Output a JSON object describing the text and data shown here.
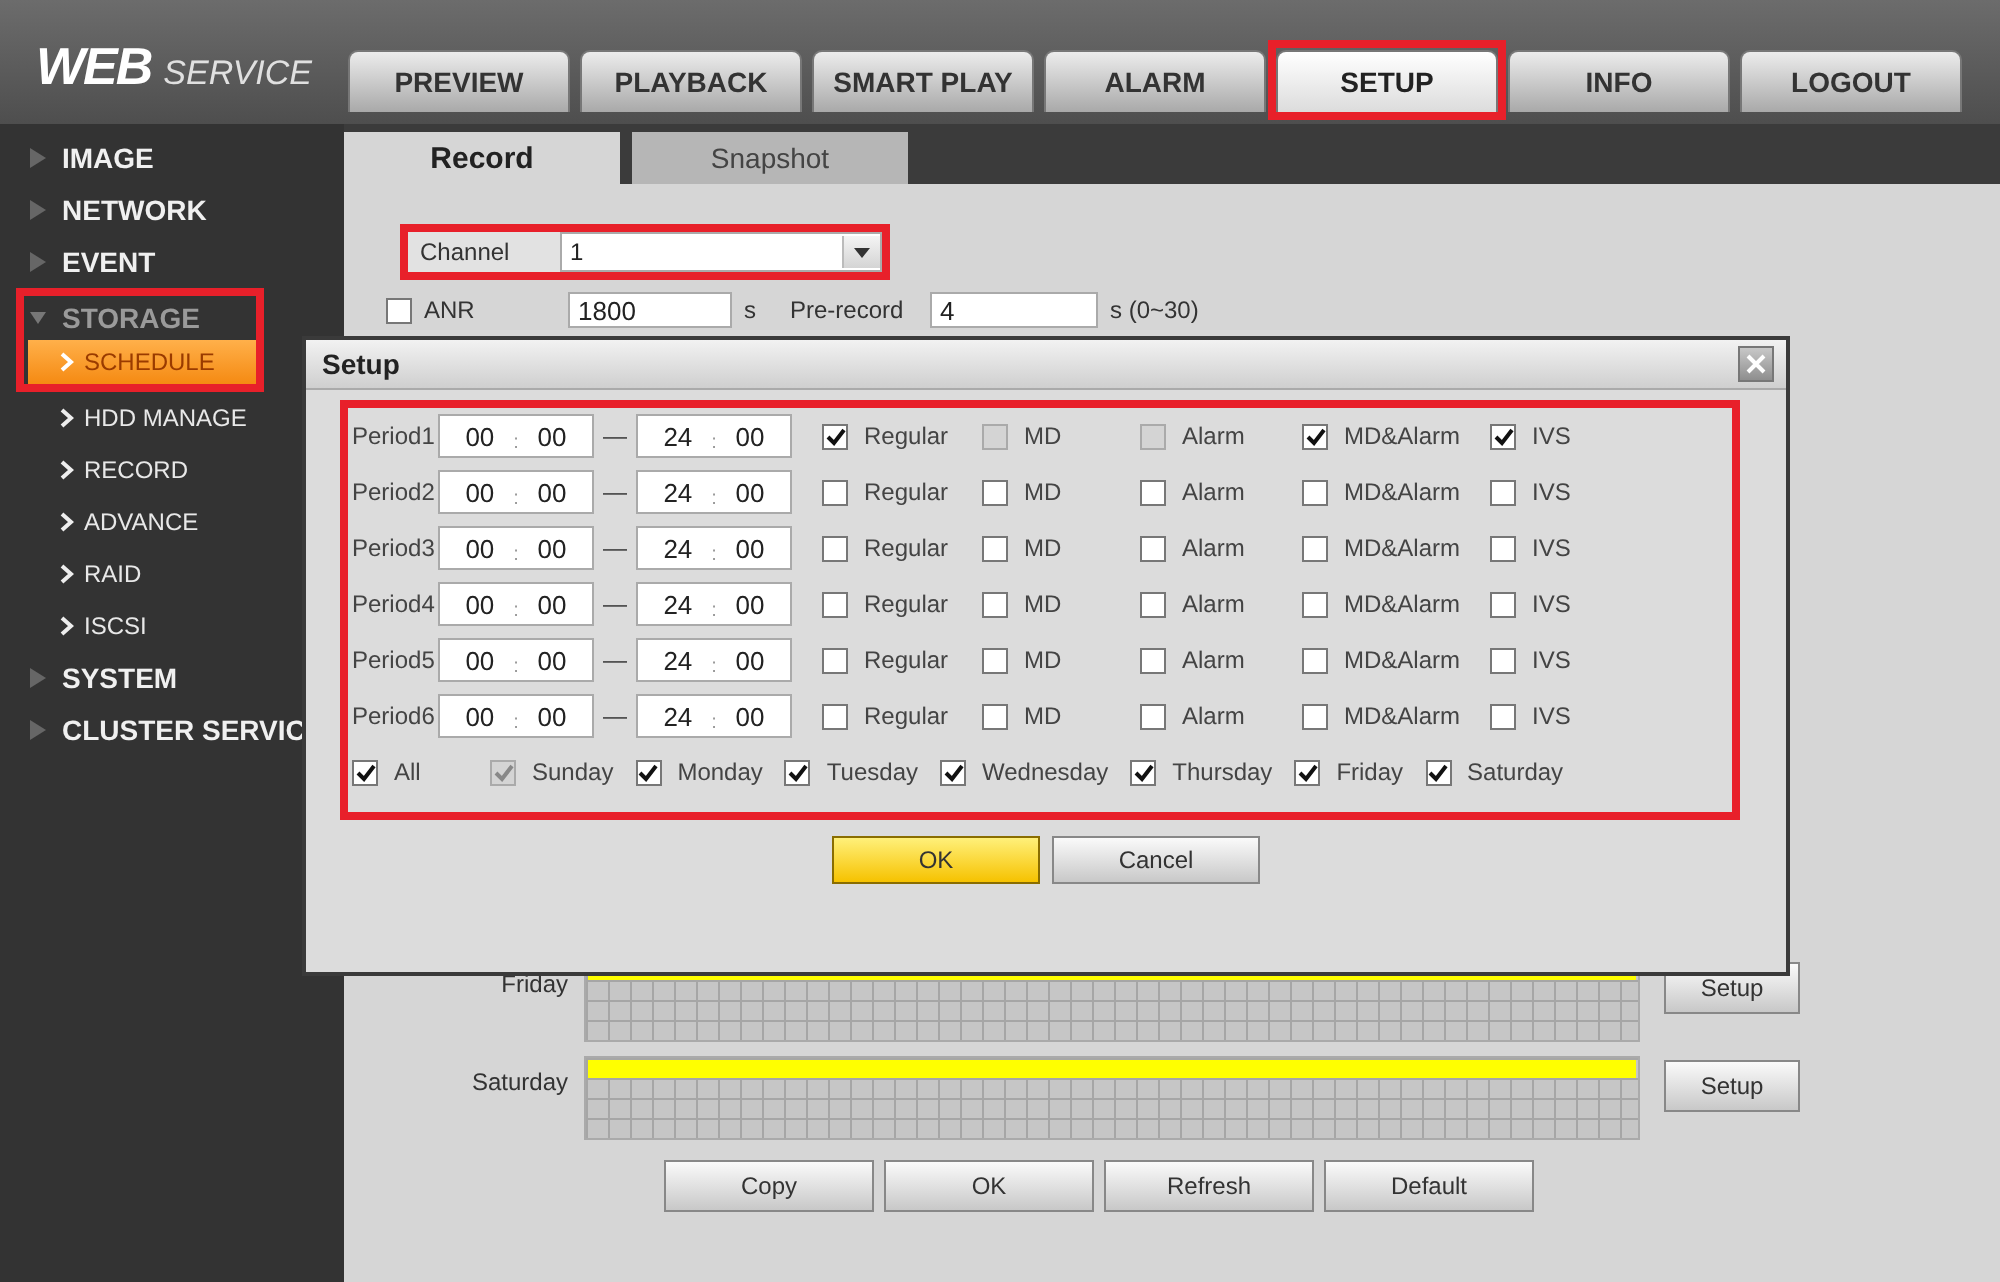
{
  "logo": {
    "primary": "WEB",
    "secondary": "SERVICE"
  },
  "nav_tabs": [
    {
      "label": "PREVIEW",
      "selected": false,
      "highlighted": false
    },
    {
      "label": "PLAYBACK",
      "selected": false,
      "highlighted": false
    },
    {
      "label": "SMART PLAY",
      "selected": false,
      "highlighted": false
    },
    {
      "label": "ALARM",
      "selected": false,
      "highlighted": false
    },
    {
      "label": "SETUP",
      "selected": true,
      "highlighted": true
    },
    {
      "label": "INFO",
      "selected": false,
      "highlighted": false
    },
    {
      "label": "LOGOUT",
      "selected": false,
      "highlighted": false
    }
  ],
  "sidebar": {
    "items": [
      {
        "label": "IMAGE",
        "expanded": false,
        "highlighted": false
      },
      {
        "label": "NETWORK",
        "expanded": false,
        "highlighted": false
      },
      {
        "label": "EVENT",
        "expanded": false,
        "highlighted": false
      },
      {
        "label": "STORAGE",
        "expanded": true,
        "highlighted": true,
        "children": [
          {
            "label": "SCHEDULE",
            "selected": true,
            "highlighted": true
          },
          {
            "label": "HDD MANAGE",
            "selected": false,
            "highlighted": false
          },
          {
            "label": "RECORD",
            "selected": false,
            "highlighted": false
          },
          {
            "label": "ADVANCE",
            "selected": false,
            "highlighted": false
          },
          {
            "label": "RAID",
            "selected": false,
            "highlighted": false
          },
          {
            "label": "ISCSI",
            "selected": false,
            "highlighted": false
          }
        ]
      },
      {
        "label": "SYSTEM",
        "expanded": false,
        "highlighted": false
      },
      {
        "label": "CLUSTER SERVIC",
        "expanded": false,
        "highlighted": false
      }
    ]
  },
  "sub_tabs": [
    {
      "label": "Record",
      "selected": true
    },
    {
      "label": "Snapshot",
      "selected": false
    }
  ],
  "channel": {
    "label": "Channel",
    "value": "1",
    "highlighted": true
  },
  "anr": {
    "label": "ANR",
    "checked": false,
    "value": "1800",
    "unit": "s",
    "prerecord_label": "Pre-record",
    "prerecord_value": "4",
    "prerecord_unit": "s (0~30)"
  },
  "schedule": [
    {
      "day": "Friday",
      "recording": true,
      "button": "Setup"
    },
    {
      "day": "Saturday",
      "recording": true,
      "button": "Setup"
    }
  ],
  "buttons": [
    "Copy",
    "OK",
    "Refresh",
    "Default"
  ],
  "dialog": {
    "title": "Setup",
    "highlighted": true,
    "periods": [
      {
        "label": "Period1",
        "start": {
          "hour": "00",
          "sep": ":",
          "minute": "00"
        },
        "dash": "—",
        "end": {
          "hour": "24",
          "sep": ":",
          "minute": "00"
        },
        "options": [
          {
            "label": "Regular",
            "checked": true,
            "disabled": false
          },
          {
            "label": "MD",
            "checked": false,
            "disabled": true
          },
          {
            "label": "Alarm",
            "checked": false,
            "disabled": true
          },
          {
            "label": "MD&Alarm",
            "checked": true,
            "disabled": false
          },
          {
            "label": "IVS",
            "checked": true,
            "disabled": false
          }
        ]
      },
      {
        "label": "Period2",
        "start": {
          "hour": "00",
          "sep": ":",
          "minute": "00"
        },
        "dash": "—",
        "end": {
          "hour": "24",
          "sep": ":",
          "minute": "00"
        },
        "options": [
          {
            "label": "Regular",
            "checked": false,
            "disabled": false
          },
          {
            "label": "MD",
            "checked": false,
            "disabled": false
          },
          {
            "label": "Alarm",
            "checked": false,
            "disabled": false
          },
          {
            "label": "MD&Alarm",
            "checked": false,
            "disabled": false
          },
          {
            "label": "IVS",
            "checked": false,
            "disabled": false
          }
        ]
      },
      {
        "label": "Period3",
        "start": {
          "hour": "00",
          "sep": ":",
          "minute": "00"
        },
        "dash": "—",
        "end": {
          "hour": "24",
          "sep": ":",
          "minute": "00"
        },
        "options": [
          {
            "label": "Regular",
            "checked": false,
            "disabled": false
          },
          {
            "label": "MD",
            "checked": false,
            "disabled": false
          },
          {
            "label": "Alarm",
            "checked": false,
            "disabled": false
          },
          {
            "label": "MD&Alarm",
            "checked": false,
            "disabled": false
          },
          {
            "label": "IVS",
            "checked": false,
            "disabled": false
          }
        ]
      },
      {
        "label": "Period4",
        "start": {
          "hour": "00",
          "sep": ":",
          "minute": "00"
        },
        "dash": "—",
        "end": {
          "hour": "24",
          "sep": ":",
          "minute": "00"
        },
        "options": [
          {
            "label": "Regular",
            "checked": false,
            "disabled": false
          },
          {
            "label": "MD",
            "checked": false,
            "disabled": false
          },
          {
            "label": "Alarm",
            "checked": false,
            "disabled": false
          },
          {
            "label": "MD&Alarm",
            "checked": false,
            "disabled": false
          },
          {
            "label": "IVS",
            "checked": false,
            "disabled": false
          }
        ]
      },
      {
        "label": "Period5",
        "start": {
          "hour": "00",
          "sep": ":",
          "minute": "00"
        },
        "dash": "—",
        "end": {
          "hour": "24",
          "sep": ":",
          "minute": "00"
        },
        "options": [
          {
            "label": "Regular",
            "checked": false,
            "disabled": false
          },
          {
            "label": "MD",
            "checked": false,
            "disabled": false
          },
          {
            "label": "Alarm",
            "checked": false,
            "disabled": false
          },
          {
            "label": "MD&Alarm",
            "checked": false,
            "disabled": false
          },
          {
            "label": "IVS",
            "checked": false,
            "disabled": false
          }
        ]
      },
      {
        "label": "Period6",
        "start": {
          "hour": "00",
          "sep": ":",
          "minute": "00"
        },
        "dash": "—",
        "end": {
          "hour": "24",
          "sep": ":",
          "minute": "00"
        },
        "options": [
          {
            "label": "Regular",
            "checked": false,
            "disabled": false
          },
          {
            "label": "MD",
            "checked": false,
            "disabled": false
          },
          {
            "label": "Alarm",
            "checked": false,
            "disabled": false
          },
          {
            "label": "MD&Alarm",
            "checked": false,
            "disabled": false
          },
          {
            "label": "IVS",
            "checked": false,
            "disabled": false
          }
        ]
      }
    ],
    "days": [
      {
        "label": "All",
        "checked": true,
        "disabled": false
      },
      {
        "label": "Sunday",
        "checked": true,
        "disabled": true
      },
      {
        "label": "Monday",
        "checked": true,
        "disabled": false
      },
      {
        "label": "Tuesday",
        "checked": true,
        "disabled": false
      },
      {
        "label": "Wednesday",
        "checked": true,
        "disabled": false
      },
      {
        "label": "Thursday",
        "checked": true,
        "disabled": false
      },
      {
        "label": "Friday",
        "checked": true,
        "disabled": false
      },
      {
        "label": "Saturday",
        "checked": true,
        "disabled": false
      }
    ],
    "buttons": [
      {
        "label": "OK",
        "kind": "primary"
      },
      {
        "label": "Cancel",
        "kind": "secondary"
      }
    ]
  }
}
